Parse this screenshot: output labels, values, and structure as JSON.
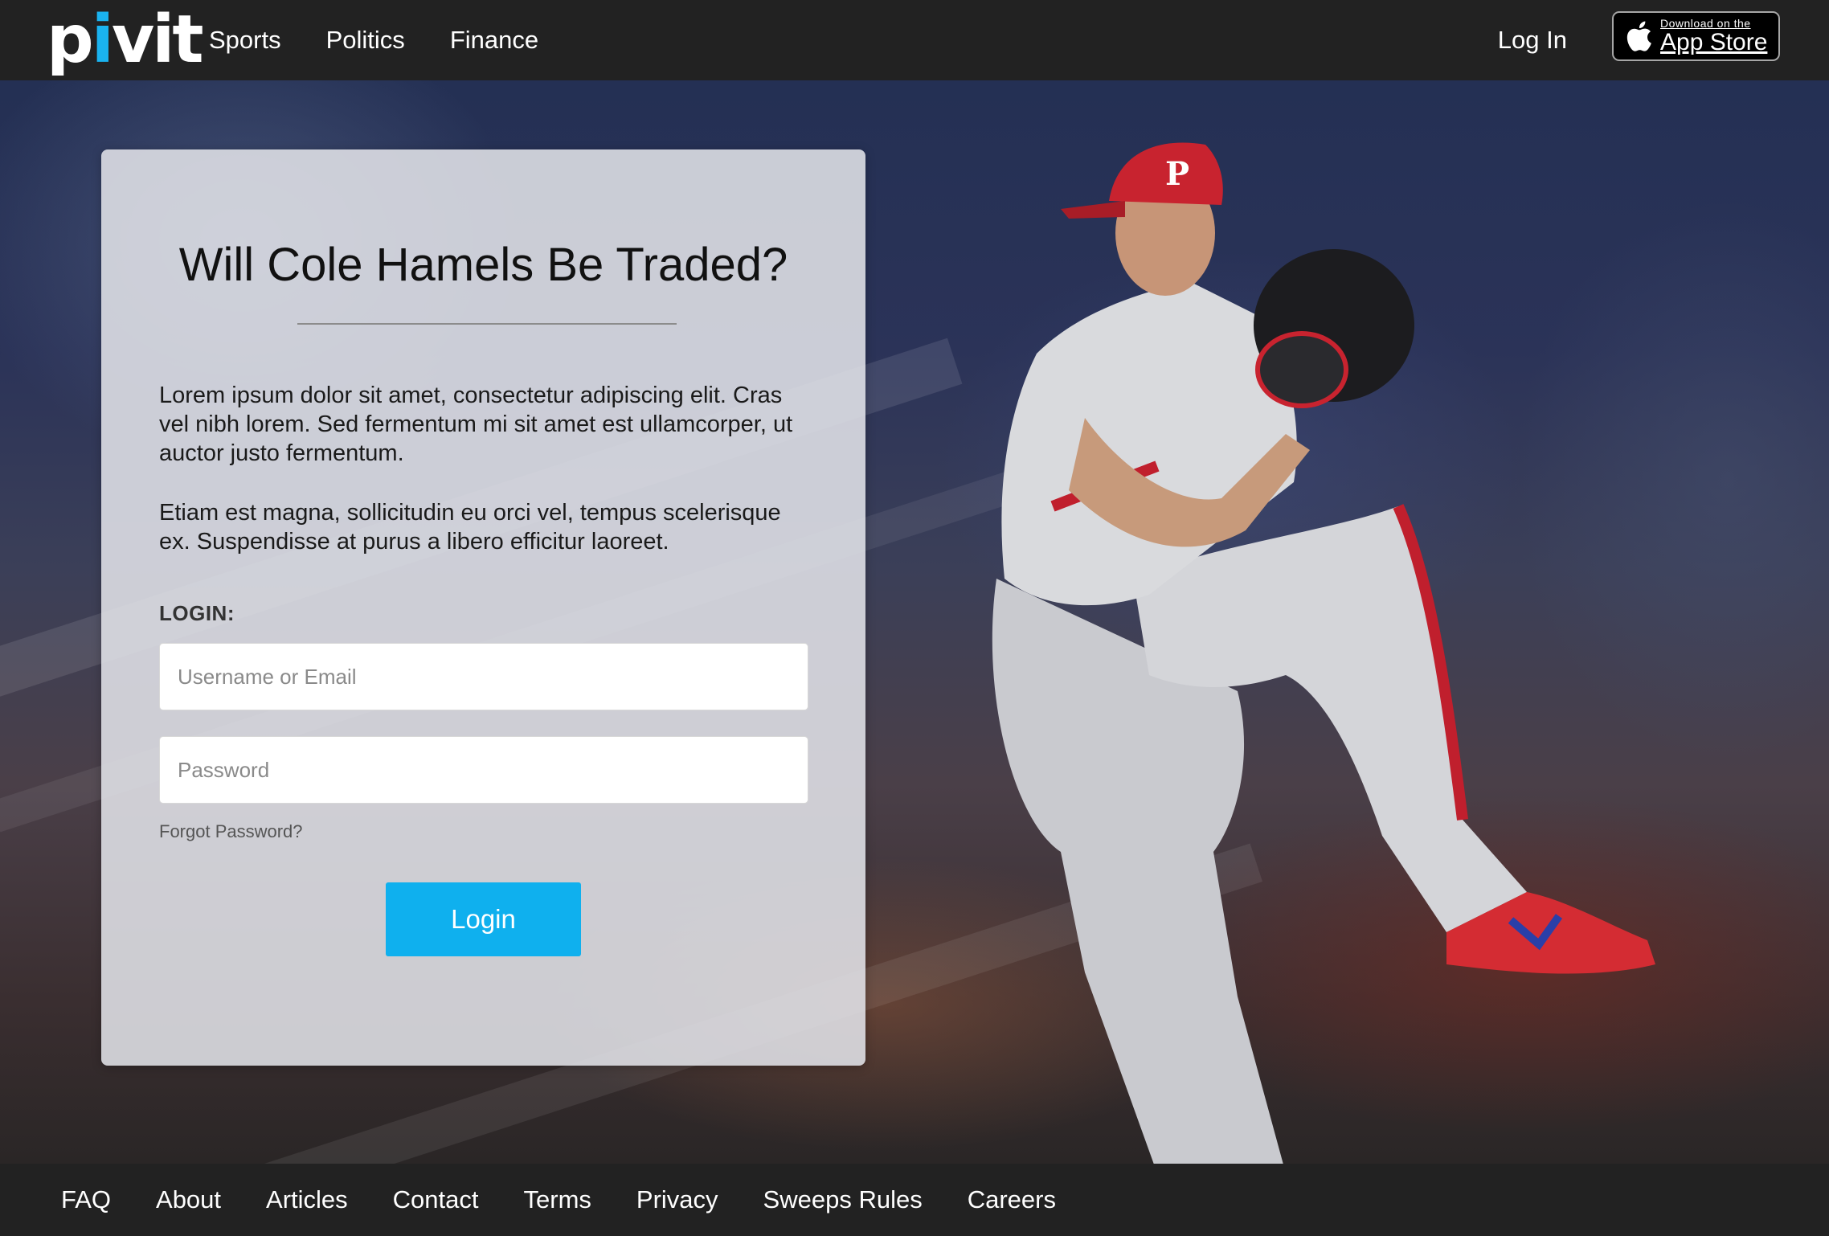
{
  "brand": {
    "logo_text_start": "p",
    "logo_dot_letter": "i",
    "logo_text_end": "vit",
    "accent": "#1ab3f0"
  },
  "header": {
    "nav": [
      "Sports",
      "Politics",
      "Finance"
    ],
    "login_link": "Log In",
    "app_store": {
      "small": "Download on the",
      "big": "App Store",
      "icon": "apple-icon"
    }
  },
  "card": {
    "title": "Will Cole Hamels Be Traded?",
    "paragraph1": "Lorem ipsum dolor sit amet, consectetur adipiscing elit. Cras vel nibh lorem. Sed fermentum mi sit amet est ullamcorper, ut auctor justo fermentum.",
    "paragraph2": "Etiam est magna, sollicitudin eu orci vel, tempus scelerisque ex. Suspendisse at purus a libero efficitur laoreet.",
    "login_label": "LOGIN:",
    "username_placeholder": "Username or Email",
    "password_placeholder": "Password",
    "forgot": "Forgot Password?",
    "login_button": "Login",
    "button_color": "#0fb0ee"
  },
  "footer": {
    "links": [
      "FAQ",
      "About",
      "Articles",
      "Contact",
      "Terms",
      "Privacy",
      "Sweeps Rules",
      "Careers"
    ]
  }
}
